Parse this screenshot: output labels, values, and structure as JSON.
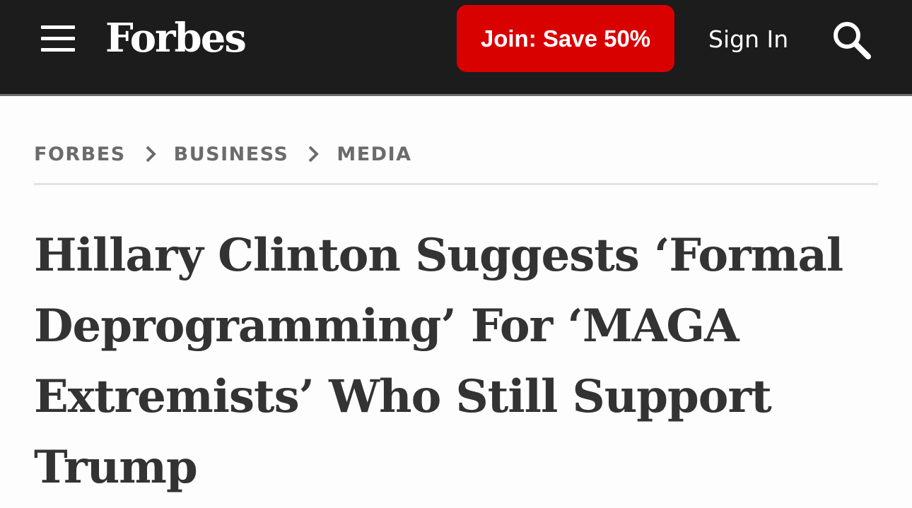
{
  "header": {
    "menu_icon": "hamburger-menu-icon",
    "logo": "Forbes",
    "join_label": "Join: Save 50%",
    "signin_label": "Sign In",
    "search_icon": "search-icon",
    "background_color": "#1c1c1c",
    "join_color": "#d90000"
  },
  "breadcrumb": {
    "items": [
      {
        "label": "FORBES"
      },
      {
        "label": "BUSINESS"
      },
      {
        "label": "MEDIA"
      }
    ],
    "separator_icon": "chevron-right-icon"
  },
  "article": {
    "headline": "Hillary Clinton Suggests ‘Formal Deprogramming’ For ‘MAGA Extremists’ Who Still Support Trump"
  }
}
